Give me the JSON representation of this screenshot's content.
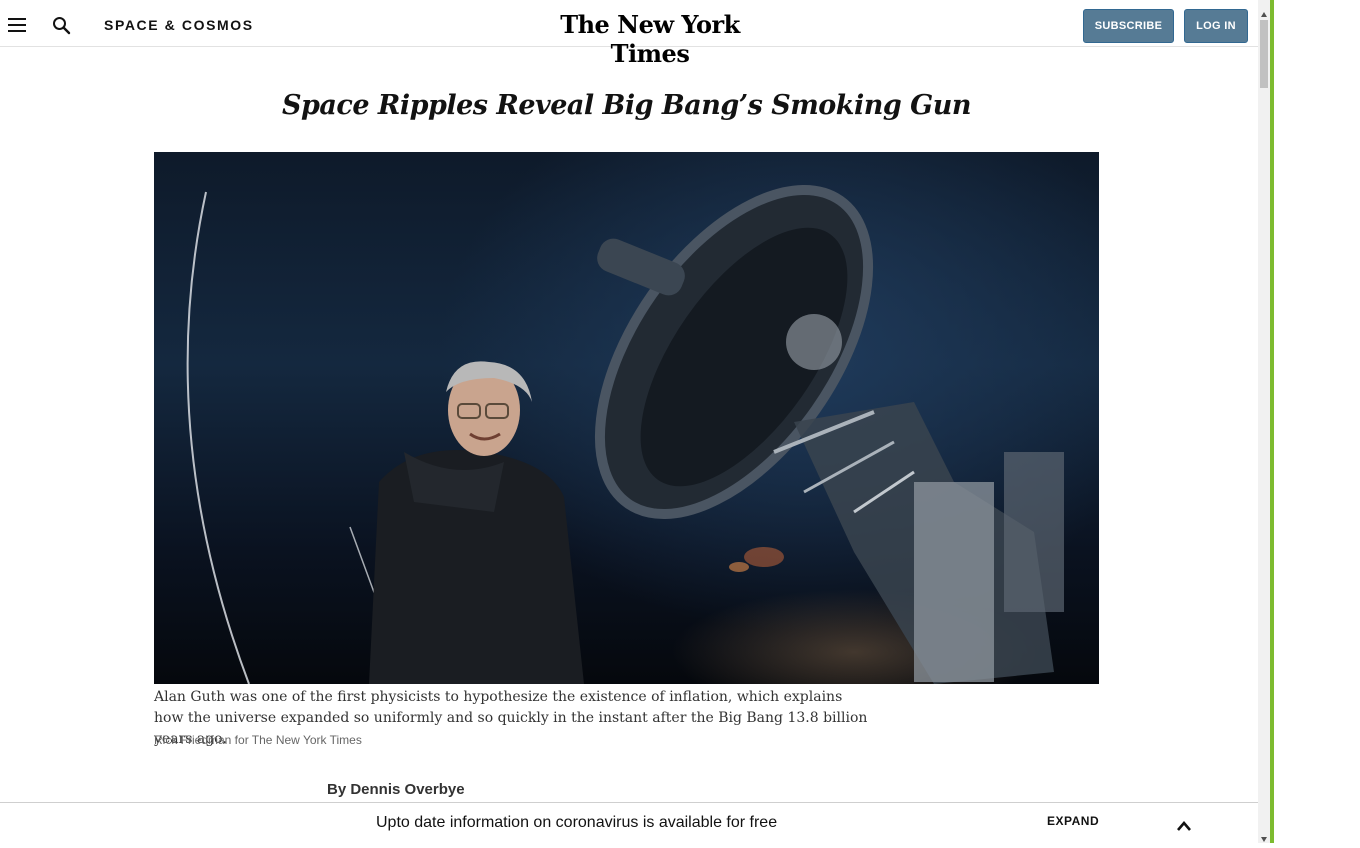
{
  "header": {
    "section": "SPACE & COSMOS",
    "masthead": "The New York Times",
    "subscribe_label": "SUBSCRIBE",
    "login_label": "LOG IN"
  },
  "article": {
    "headline": "Space Ripples Reveal Big Bang’s Smoking Gun",
    "caption": "Alan Guth was one of the first physicists to hypothesize the existence of inflation, which explains how the universe expanded so uniformly and so quickly in the instant after the Big Bang 13.8 billion years ago.",
    "credit": "Rick Friedman for The New York Times",
    "byline_prefix": "By ",
    "author": "Dennis Overbye"
  },
  "banner": {
    "text": "Upto date information on coronavirus is available for free",
    "expand_label": "EXPAND"
  },
  "colors": {
    "button_bg": "#567b95",
    "accent": "#7dbb2f"
  },
  "icons": [
    "menu-icon",
    "search-icon",
    "chevron-up-icon"
  ]
}
